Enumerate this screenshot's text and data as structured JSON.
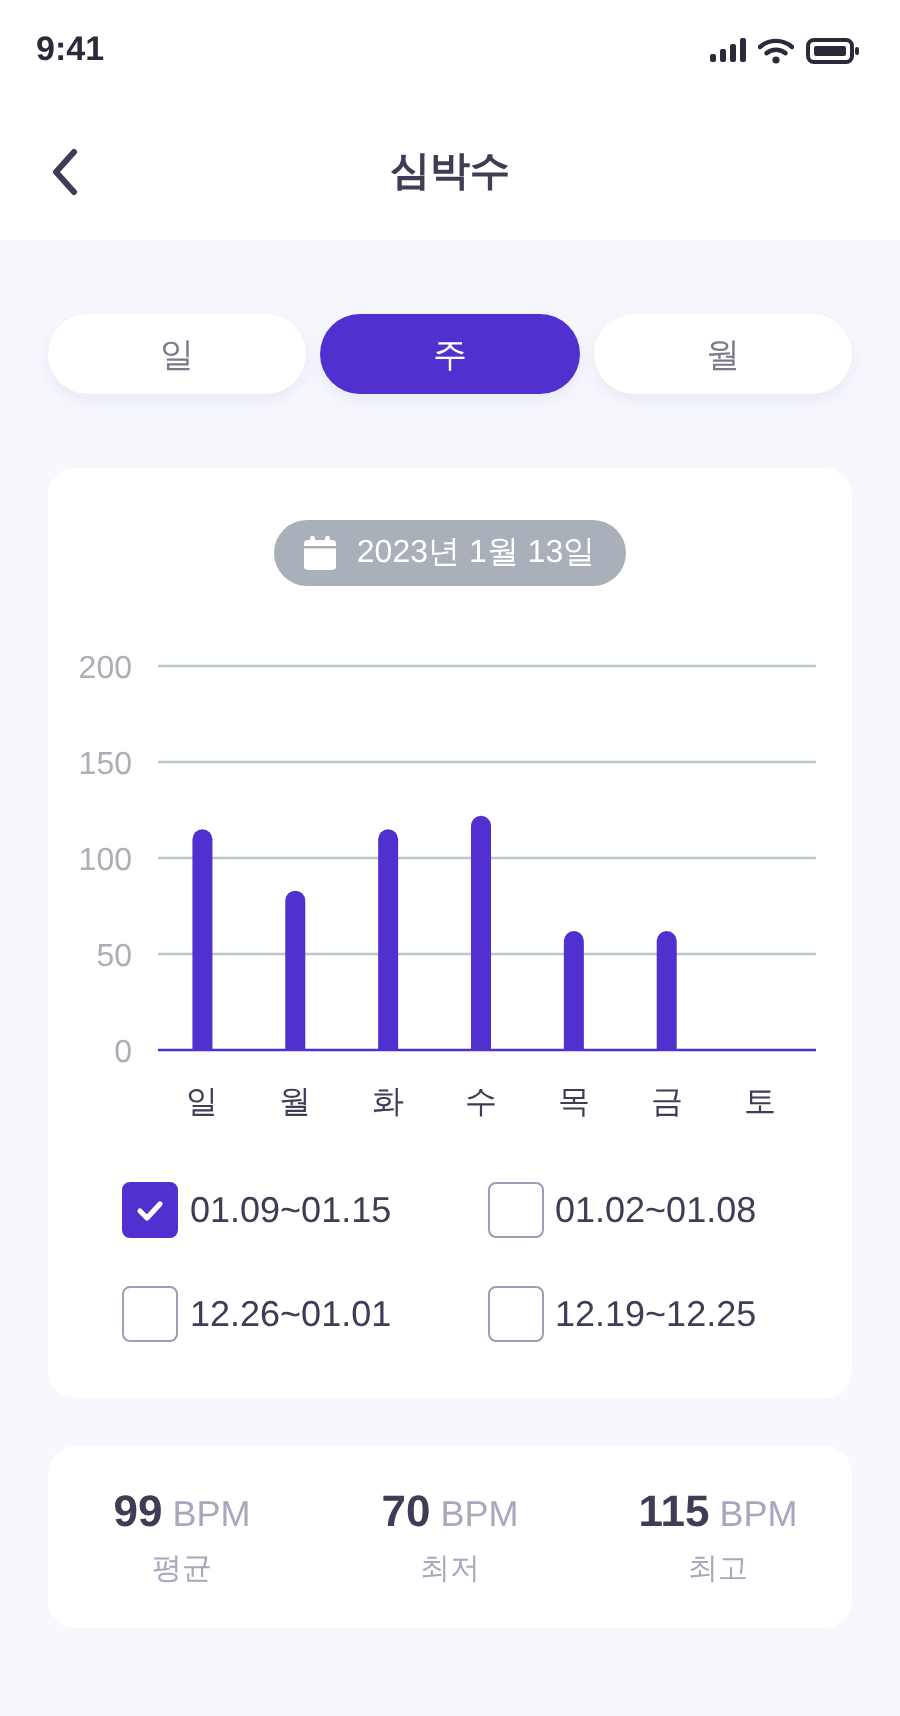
{
  "status_bar": {
    "time": "9:41"
  },
  "header": {
    "title": "심박수"
  },
  "tabs": [
    {
      "label": "일",
      "selected": false
    },
    {
      "label": "주",
      "selected": true
    },
    {
      "label": "월",
      "selected": false
    }
  ],
  "chart_card": {
    "date": "2023년 1월 13일",
    "chart_data": {
      "type": "bar",
      "grid": true,
      "categories": [
        "일",
        "월",
        "화",
        "수",
        "목",
        "금",
        "토"
      ],
      "ylim": [
        0,
        200
      ],
      "yticks": [
        0,
        50,
        100,
        150,
        200
      ],
      "series": [
        {
          "color": "#5030cf",
          "values": [
            115,
            83,
            115,
            122,
            62,
            62,
            null
          ]
        }
      ]
    },
    "weeks": [
      {
        "label": "01.09~01.15",
        "checked": true
      },
      {
        "label": "01.02~01.08",
        "checked": false
      },
      {
        "label": "12.26~01.01",
        "checked": false
      },
      {
        "label": "12.19~12.25",
        "checked": false
      }
    ]
  },
  "stats": [
    {
      "value": "99",
      "unit": "BPM",
      "label": "평균"
    },
    {
      "value": "70",
      "unit": "BPM",
      "label": "최저"
    },
    {
      "value": "115",
      "unit": "BPM",
      "label": "최고"
    }
  ]
}
